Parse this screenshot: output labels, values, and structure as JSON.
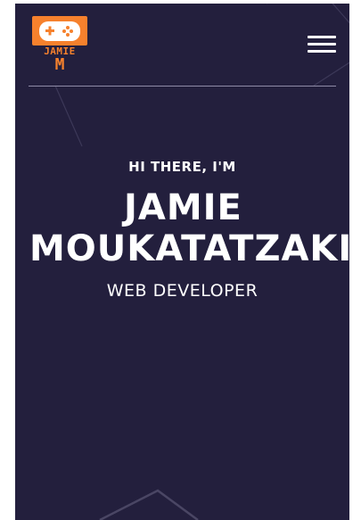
{
  "header": {
    "logo": {
      "icon": "gamepad-icon",
      "name_text": "JAMIE",
      "initial_text": "M",
      "color": "#f6812d"
    },
    "menu_icon": "hamburger-menu-icon"
  },
  "hero": {
    "greeting": "HI THERE, I'M",
    "name_line1": "JAMIE",
    "name_line2": "MOUKATATZAKIS",
    "role": "WEB DEVELOPER"
  },
  "colors": {
    "background": "#231f3d",
    "accent": "#f6812d",
    "text": "#ffffff",
    "divider": "#8f8ba6"
  }
}
